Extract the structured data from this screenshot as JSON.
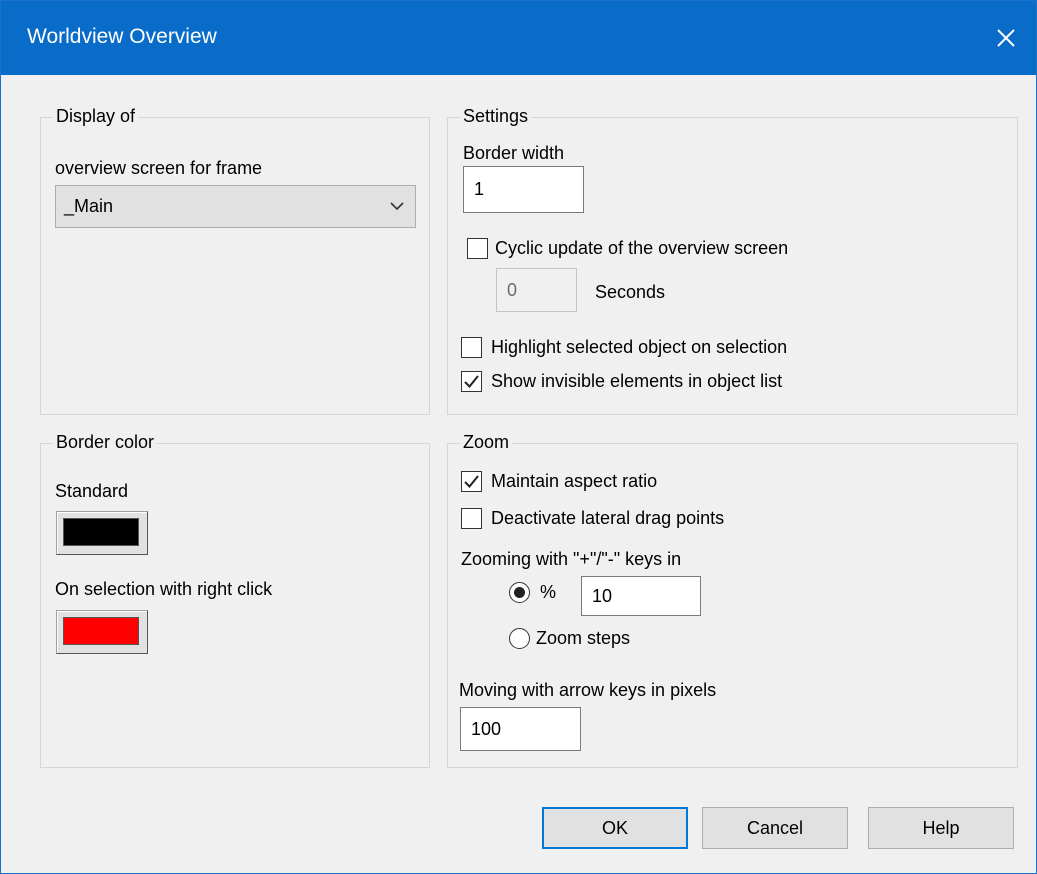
{
  "window": {
    "title": "Worldview Overview"
  },
  "display_group": {
    "label": "Display of",
    "frame_label": "overview screen for frame",
    "frame_value": "_Main"
  },
  "settings_group": {
    "label": "Settings",
    "border_width_label": "Border width",
    "border_width_value": "1",
    "cyclic_update": {
      "label": "Cyclic update of the overview screen",
      "checked": false
    },
    "seconds_value": "0",
    "seconds_label": "Seconds",
    "highlight_selected": {
      "label": "Highlight selected object on selection",
      "checked": false
    },
    "show_invisible": {
      "label": "Show invisible elements in object list",
      "checked": true
    }
  },
  "border_color_group": {
    "label": "Border color",
    "standard_label": "Standard",
    "standard_color": "#000000",
    "selection_label": "On selection with right click",
    "selection_color": "#ff0000"
  },
  "zoom_group": {
    "label": "Zoom",
    "maintain_aspect": {
      "label": "Maintain aspect ratio",
      "checked": true
    },
    "deactivate_drag": {
      "label": "Deactivate lateral drag points",
      "checked": false
    },
    "zooming_label": "Zooming with \"+\"/\"-\" keys in",
    "percent_radio": {
      "label": "%",
      "selected": true
    },
    "percent_value": "10",
    "zoom_steps_radio": {
      "label": "Zoom steps",
      "selected": false
    },
    "moving_label": "Moving with arrow keys in pixels",
    "moving_value": "100"
  },
  "buttons": {
    "ok": "OK",
    "cancel": "Cancel",
    "help": "Help"
  },
  "colors": {
    "titlebar": "#0a6cc9",
    "accent": "#0078d7",
    "dialog_bg": "#f0f0f0"
  }
}
